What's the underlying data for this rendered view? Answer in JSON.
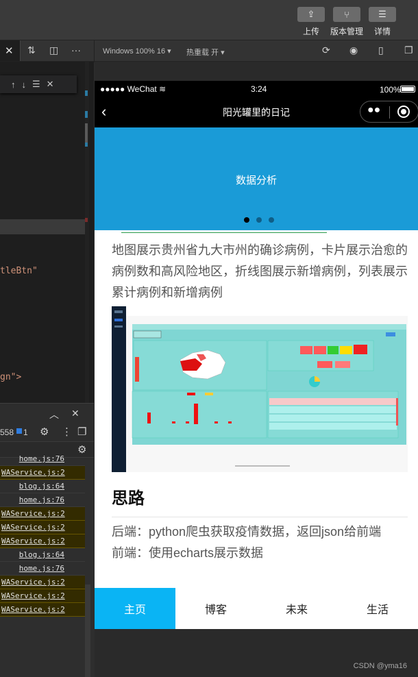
{
  "toolbar": {
    "upload_label": "上传",
    "version_label": "版本管理",
    "details_label": "详情"
  },
  "toolbar2": {
    "device": "Windows 100% 16",
    "hot_reload": "热重载 开"
  },
  "editor": {
    "code_1": "tleBtn\"",
    "code_2": "gn\">"
  },
  "console": {
    "count": "558",
    "badge": "1",
    "logs": [
      {
        "file": "home.js:76",
        "warn": false
      },
      {
        "file": "WAService.js:2",
        "warn": true
      },
      {
        "file": "blog.js:64",
        "warn": false
      },
      {
        "file": "home.js:76",
        "warn": false
      },
      {
        "file": "WAService.js:2",
        "warn": true
      },
      {
        "file": "WAService.js:2",
        "warn": true
      },
      {
        "file": "WAService.js:2",
        "warn": true
      },
      {
        "file": "blog.js:64",
        "warn": false
      },
      {
        "file": "home.js:76",
        "warn": false
      },
      {
        "file": "WAService.js:2",
        "warn": true
      },
      {
        "file": "WAService.js:2",
        "warn": true
      },
      {
        "file": "WAService.js:2",
        "warn": true
      }
    ]
  },
  "phone": {
    "carrier": "●●●●● WeChat",
    "time": "3:24",
    "battery": "100%",
    "title": "阳光罐里的日记",
    "banner_title": "数据分析",
    "paragraph_1": "地图展示贵州省九大市州的确诊病例，卡片展示治愈的病例数和高风险地区，折线图展示新增病例，列表展示累计病例和新增病例",
    "heading": "思路",
    "paragraph_2": "后端：python爬虫获取疫情数据，返回json给前端",
    "paragraph_3": "前端：使用echarts展示数据"
  },
  "tabs": [
    "主页",
    "博客",
    "未来",
    "生活"
  ],
  "watermark": "CSDN @yma16"
}
